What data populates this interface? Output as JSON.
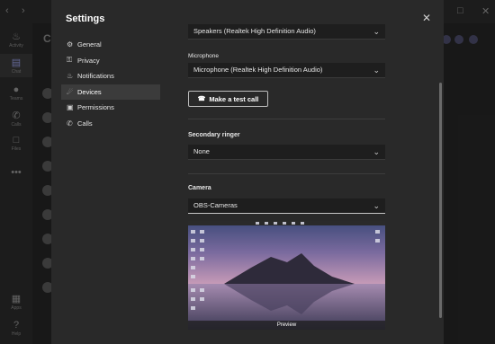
{
  "dialog": {
    "title": "Settings",
    "nav": [
      {
        "label": "General",
        "icon": "gear-icon"
      },
      {
        "label": "Privacy",
        "icon": "lock-icon"
      },
      {
        "label": "Notifications",
        "icon": "bell-icon"
      },
      {
        "label": "Devices",
        "icon": "devices-icon"
      },
      {
        "label": "Permissions",
        "icon": "shield-icon"
      },
      {
        "label": "Calls",
        "icon": "phone-icon"
      }
    ],
    "active_nav": "Devices"
  },
  "devices": {
    "speaker_value": "Speakers (Realtek High Definition Audio)",
    "microphone_label": "Microphone",
    "microphone_value": "Microphone (Realtek High Definition Audio)",
    "test_call_label": "Make a test call",
    "secondary_ringer_label": "Secondary ringer",
    "secondary_ringer_value": "None",
    "camera_label": "Camera",
    "camera_value": "OBS-Cameras",
    "preview_label": "Preview"
  },
  "background": {
    "chat_title": "Cl",
    "rail": [
      {
        "label": "Activity",
        "icon": "bell-icon"
      },
      {
        "label": "Chat",
        "icon": "chat-icon"
      },
      {
        "label": "Teams",
        "icon": "teams-icon"
      },
      {
        "label": "Calls",
        "icon": "phone-icon"
      },
      {
        "label": "Files",
        "icon": "file-icon"
      },
      {
        "label": "",
        "icon": "more-icon"
      },
      {
        "label": "Apps",
        "icon": "apps-icon"
      },
      {
        "label": "Help",
        "icon": "help-icon"
      }
    ]
  },
  "colors": {
    "accent": "#9aa0ea",
    "dialog_bg": "#292929",
    "select_bg": "#1e1e1e"
  }
}
